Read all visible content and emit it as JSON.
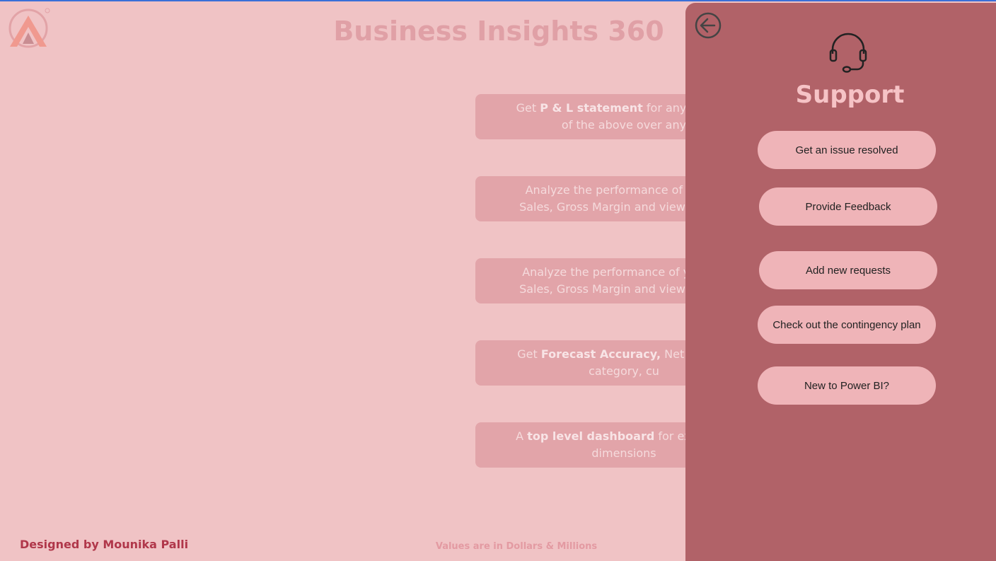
{
  "app": {
    "title": "Business Insights 360",
    "designed_by": "Designed by Mounika Palli",
    "values_note": "Values are in Dollars & Millions"
  },
  "cards": [
    {
      "line1_a": "Get ",
      "line1_b": "P & L statement",
      "line1_c": " for any custom",
      "line2": "of the above over any"
    },
    {
      "line1_a": "Analyze the performance of your p",
      "line1_b": "",
      "line1_c": "",
      "line2": "Sales, Gross Margin and view the sar"
    },
    {
      "line1_a": "Analyze the performance of your cu",
      "line1_b": "",
      "line1_c": "",
      "line2": "Sales, Gross Margin and view the sar"
    },
    {
      "line1_a": "Get ",
      "line1_b": "Forecast Accuracy,",
      "line1_c": " Net Error ar",
      "line2": "category, cu"
    },
    {
      "line1_a": "A ",
      "line1_b": "top level dashboard",
      "line1_c": " for executive",
      "line2": "dimensions"
    }
  ],
  "support": {
    "title": "Support",
    "buttons": [
      {
        "label": "Get an issue resolved"
      },
      {
        "label": "Provide Feedback"
      },
      {
        "label": "Add new requests"
      },
      {
        "label": "Check out the contingency plan"
      },
      {
        "label": "New to Power BI?"
      }
    ]
  },
  "icons": {
    "logo": "atliq-logo-icon",
    "back": "back-arrow-icon",
    "headset": "headset-icon"
  },
  "colors": {
    "background": "#f0c3c5",
    "panel": "#b16268",
    "button": "#efb4b8",
    "title": "#e0a0a6",
    "designed_by": "#b0374a"
  }
}
